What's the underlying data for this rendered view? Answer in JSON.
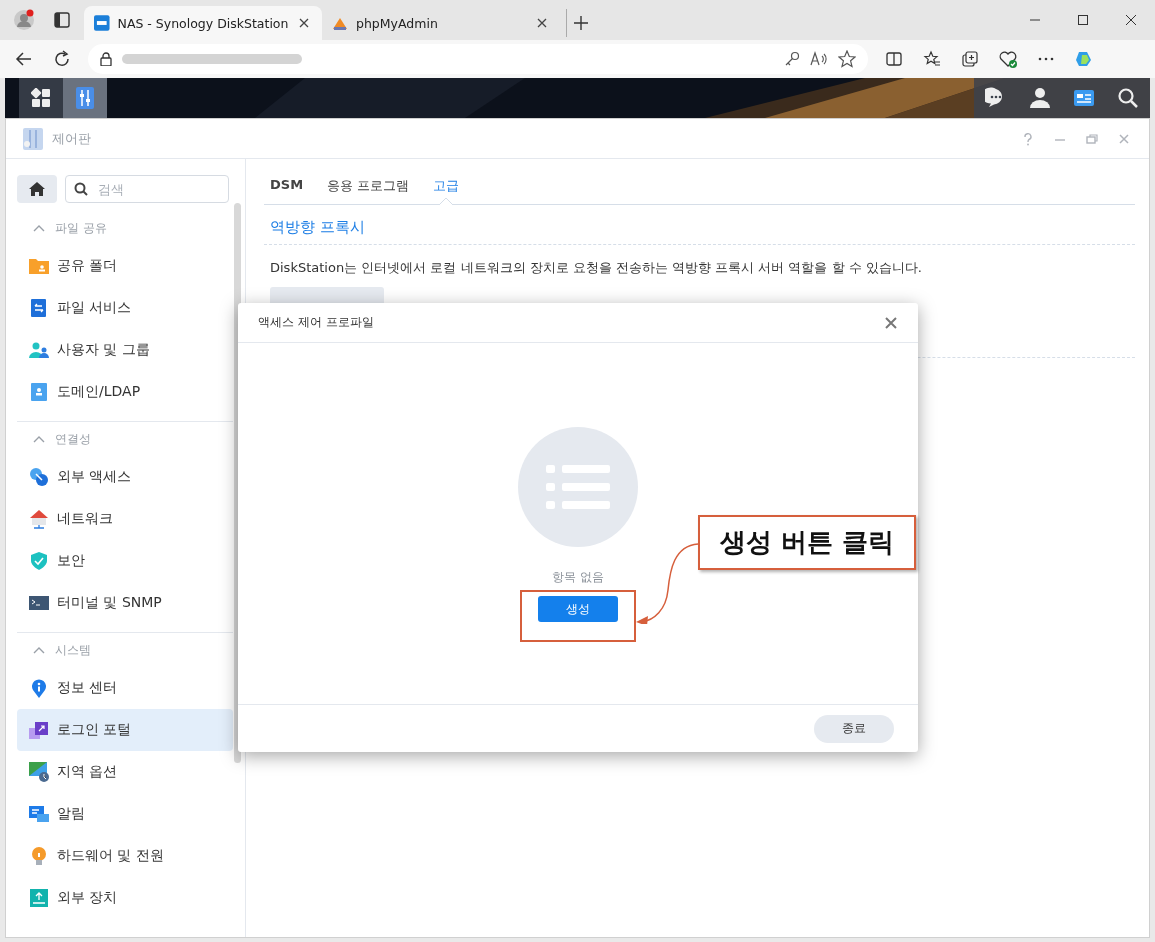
{
  "browser": {
    "tabs": [
      {
        "title": "NAS - Synology DiskStation",
        "selected": true
      },
      {
        "title": "phpMyAdmin",
        "selected": false
      }
    ]
  },
  "control_panel": {
    "title": "제어판",
    "search": {
      "placeholder": "검색"
    },
    "sidebar": [
      {
        "title": "파일 공유",
        "expanded": true,
        "items": [
          {
            "label": "공유 폴더",
            "selected": false
          },
          {
            "label": "파일 서비스",
            "selected": false
          },
          {
            "label": "사용자 및 그룹",
            "selected": false
          },
          {
            "label": "도메인/LDAP",
            "selected": false
          }
        ]
      },
      {
        "title": "연결성",
        "expanded": true,
        "items": [
          {
            "label": "외부 액세스",
            "selected": false
          },
          {
            "label": "네트워크",
            "selected": false
          },
          {
            "label": "보안",
            "selected": false
          },
          {
            "label": "터미널 및 SNMP",
            "selected": false
          }
        ]
      },
      {
        "title": "시스템",
        "expanded": true,
        "items": [
          {
            "label": "정보 센터",
            "selected": false
          },
          {
            "label": "로그인 포털",
            "selected": true
          },
          {
            "label": "지역 옵션",
            "selected": false
          },
          {
            "label": "알림",
            "selected": false
          },
          {
            "label": "하드웨어 및 전원",
            "selected": false
          },
          {
            "label": "외부 장치",
            "selected": false
          }
        ]
      }
    ],
    "tabs": [
      {
        "label": "DSM",
        "selected": false
      },
      {
        "label": "응용 프로그램",
        "selected": false
      },
      {
        "label": "고급",
        "selected": true
      }
    ],
    "section_title": "역방향 프록시",
    "description": "DiskStation는 인터넷에서 로컬 네트워크의 장치로 요청을 전송하는 역방향 프록시 서버 역할을 할 수 있습니다."
  },
  "dialog": {
    "title": "액세스 제어 프로파일",
    "empty_text": "항목 없음",
    "create_button": "생성",
    "close_button": "종료"
  },
  "annotation": {
    "text": "생성 버튼 클릭"
  }
}
